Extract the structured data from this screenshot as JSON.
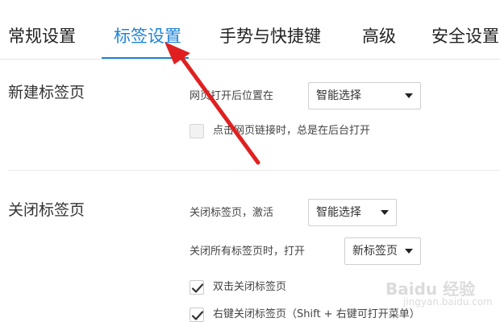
{
  "tabs": [
    {
      "label": "常规设置",
      "active": false
    },
    {
      "label": "标签设置",
      "active": true
    },
    {
      "label": "手势与快捷键",
      "active": false
    },
    {
      "label": "高级",
      "active": false
    },
    {
      "label": "安全设置",
      "active": false
    }
  ],
  "colors": {
    "accent": "#1f84d6",
    "annotation_arrow": "#e02020"
  },
  "new_tab_section": {
    "title": "新建标签页",
    "open_position_label": "网页打开后位置在",
    "open_position_value": "智能选择",
    "background_link_label": "点击网页链接时，总是在后台打开",
    "background_link_checked": false
  },
  "close_tab_section": {
    "title": "关闭标签页",
    "activate_label": "关闭标签页，激活",
    "activate_value": "智能选择",
    "close_all_label": "关闭所有标签页时，打开",
    "close_all_value": "新标签页",
    "double_click_label": "双击关闭标签页",
    "double_click_checked": true,
    "right_click_label": "右键关闭标签页（Shift + 右键可打开菜单）",
    "right_click_checked": true
  },
  "watermark": {
    "text": "Baidu 经验",
    "sub": "jingyan.baidu.com"
  },
  "icons": {
    "dropdown": "chevron-down-icon",
    "check": "check-icon",
    "annotation": "red-arrow-icon"
  }
}
